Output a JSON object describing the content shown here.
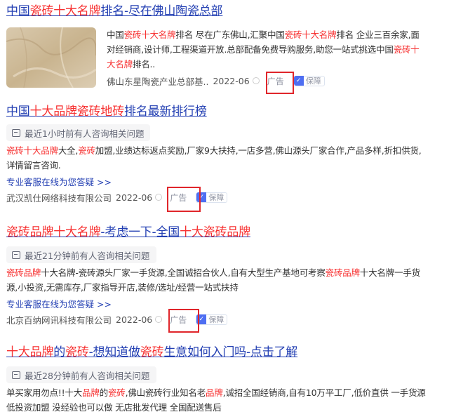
{
  "results": [
    {
      "title_parts": [
        "中国",
        "瓷砖十大名牌",
        "排名-尽在佛山陶瓷总部"
      ],
      "desc_parts": [
        "中国",
        "瓷砖十大名牌",
        "排名 尽在广东佛山,汇聚中国",
        "瓷砖十大名牌",
        "排名 企业三百余家,面对经销商,设计师,工程渠道开放.总部配备免费导购服务,助您一站式挑选中国",
        "瓷砖十大名牌",
        "排名.."
      ],
      "source": "佛山东星陶瓷产业总部基..",
      "date": "2022-06",
      "ad_label": "广告",
      "bao_label": "保障",
      "image_alt": "marble-tile-thumbnail"
    },
    {
      "title_parts": [
        "中国",
        "十大品牌瓷砖地砖",
        "排名最新排行榜"
      ],
      "consult": "最近1小时前有人咨询相关问题",
      "desc_parts": [
        "瓷砖十大品牌",
        "大全,",
        "瓷砖",
        "加盟,业绩达标返点奖励,厂家9大扶持,一店多营,佛山源头厂家合作,产品多样,折扣供货,详情留言咨询."
      ],
      "link": "专业客服在线为您答疑 >>",
      "source": "武汉凯仕网络科技有限公司",
      "date": "2022-06",
      "ad_label": "广告",
      "bao_label": "保障"
    },
    {
      "title_parts": [
        "瓷砖品牌十大名牌",
        "-考虑一下-全国",
        "十大瓷砖品牌"
      ],
      "consult": "最近21分钟前有人咨询相关问题",
      "desc_parts": [
        "瓷砖品牌",
        "十大名牌-瓷砖源头厂家一手货源,全国诚招合伙人,自有大型生产基地可考察",
        "瓷砖品牌",
        "十大名牌一手货源,小投资,无需库存,厂家指导开店,装修/选址/经营一站式扶持"
      ],
      "link": "专业客服在线为您答疑 >>",
      "source": "北京百纳网讯科技有限公司",
      "date": "2022-06",
      "ad_label": "广告",
      "bao_label": "保障"
    },
    {
      "title_parts": [
        "十大品牌",
        "的",
        "瓷砖",
        "-想知道做",
        "瓷砖",
        "生意如何入门吗-点击了解"
      ],
      "consult": "最近28分钟前有人咨询相关问题",
      "desc_parts": [
        "单买家用勿点!!十大",
        "品牌",
        "的",
        "瓷砖",
        ",佛山瓷砖行业知名老",
        "品牌",
        ",诚招全国经销商,自有10万平工厂,低价直供 一手货源 低投资加盟 没经验也可以做 无店批发代理 全国配送售后"
      ]
    }
  ]
}
